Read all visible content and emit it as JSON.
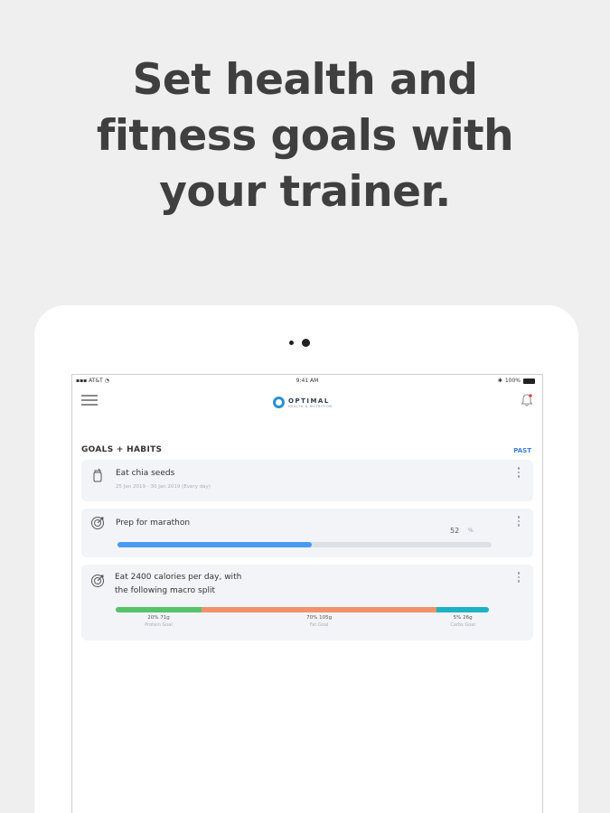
{
  "headline": {
    "line1": "Set health and",
    "line2": "fitness goals with",
    "line3": "your trainer."
  },
  "statusbar": {
    "carrier": "AT&T",
    "time": "9:41 AM",
    "battery": "100%"
  },
  "navbar": {
    "logo_title": "OPTIMAL",
    "logo_subtitle": "HEALTH & NUTRITION"
  },
  "section": {
    "title": "GOALS + HABITS",
    "past_label": "PAST"
  },
  "goals": [
    {
      "title": "Eat chia seeds",
      "date": "25 Jan 2019 - 30 Jan 2019 (Every day)",
      "icon": "jar-icon"
    },
    {
      "title": "Prep for marathon",
      "value": "52",
      "unit": "%",
      "progress": 0.52,
      "icon": "target-icon"
    },
    {
      "title_line1": "Eat 2400 calories per day, with",
      "title_line2": "the following macro split",
      "icon": "target-icon",
      "macros": [
        {
          "label": "20% 71g",
          "sub": "Protein Goal",
          "fraction": 0.23,
          "color": "#56c26a"
        },
        {
          "label": "70% 105g",
          "sub": "Fat Goal",
          "fraction": 0.63,
          "color": "#f2926a"
        },
        {
          "label": "5% 26g",
          "sub": "Carbs Goal",
          "fraction": 0.14,
          "color": "#1cb3c4"
        }
      ]
    }
  ],
  "colors": {
    "accent": "#3a7fd5",
    "progress": "#4a9af0",
    "card_bg": "#f2f4f7",
    "page_bg": "#efefef"
  }
}
